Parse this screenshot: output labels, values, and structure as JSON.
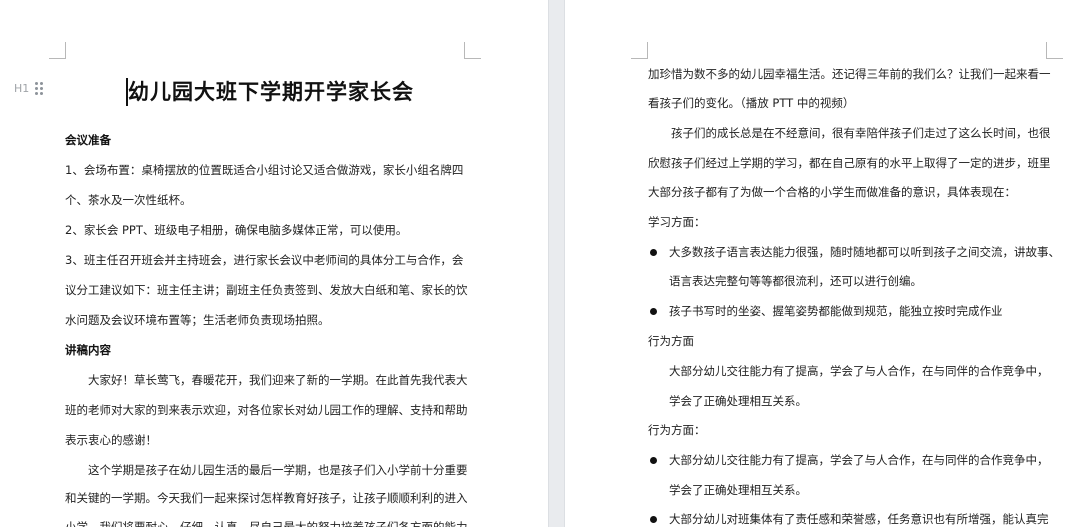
{
  "left_page": {
    "heading_tool": {
      "level_label": "H1"
    },
    "title": "幼儿园大班下学期开学家长会",
    "lines": [
      "会议准备",
      "1、会场布置：桌椅摆放的位置既适合小组讨论又适合做游戏，家长小组名牌四",
      "个、茶水及一次性纸杯。",
      "2、家长会 PPT、班级电子相册，确保电脑多媒体正常，可以使用。",
      "3、班主任召开班会并主持班会，进行家长会议中老师间的具体分工与合作，会",
      "议分工建议如下：班主任主讲；副班主任负责签到、发放大白纸和笔、家长的饮",
      "水问题及会议环境布置等；生活老师负责现场拍照。",
      "讲稿内容",
      "大家好！草长莺飞，春暖花开，我们迎来了新的一学期。在此首先我代表大",
      "班的老师对大家的到来表示欢迎，对各位家长对幼儿园工作的理解、支持和帮助",
      "表示衷心的感谢！",
      "这个学期是孩子在幼儿园生活的最后一学期，也是孩子们入小学前十分重要",
      "和关键的一学期。今天我们一起来探讨怎样教育好孩子，让孩子顺顺利利的进入",
      "小学，我们将要耐心、仔细、认真、尽自己最大的努力培养孩子们各方面的能力"
    ]
  },
  "right_page": {
    "lines": [
      "加珍惜为数不多的幼儿园幸福生活。还记得三年前的我们么？让我们一起来看一",
      "看孩子们的变化。（播放 PTT 中的视频）",
      "孩子们的成长总是在不经意间，很有幸陪伴孩子们走过了这么长时间，也很",
      "欣慰孩子们经过上学期的学习，都在自己原有的水平上取得了一定的进步，班里",
      "大部分孩子都有了为做一个合格的小学生而做准备的意识，具体表现在：",
      "学习方面：",
      "大多数孩子语言表达能力很强，随时随地都可以听到孩子之间交流，讲故事、",
      "语言表达完整句等等都很流利，还可以进行创编。",
      "孩子书写时的坐姿、握笔姿势都能做到规范，能独立按时完成作业",
      "行为方面",
      "大部分幼儿交往能力有了提高，学会了与人合作，在与同伴的合作竞争中，",
      "学会了正确处理相互关系。",
      "行为方面：",
      "大部分幼儿交往能力有了提高，学会了与人合作，在与同伴的合作竞争中，",
      "学会了正确处理相互关系。",
      "大部分幼儿对班集体有了责任感和荣誉感，任务意识也有所增强，能认真完"
    ]
  }
}
